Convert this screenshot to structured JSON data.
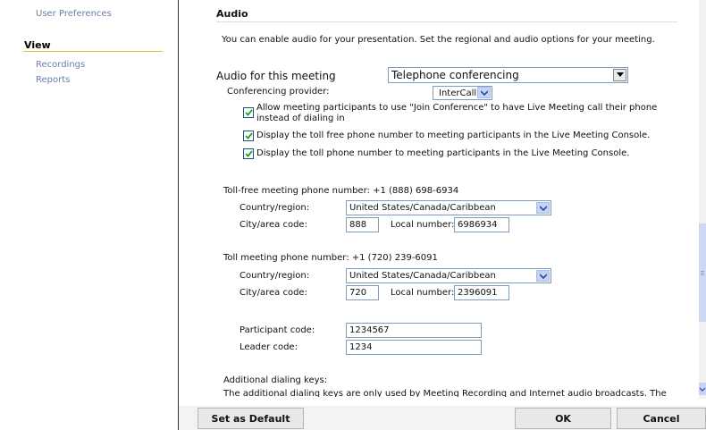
{
  "sidebar": {
    "user_preferences": "User Preferences",
    "view_heading": "View",
    "recordings": "Recordings",
    "reports": "Reports"
  },
  "audio": {
    "section_title": "Audio",
    "intro": "You can enable audio for your presentation. Set the regional and audio options for your meeting.",
    "audio_for_meeting_label": "Audio for this meeting",
    "audio_for_meeting_value": "Telephone conferencing",
    "provider_label": "Conferencing provider:",
    "provider_value": "InterCall",
    "checkboxes": [
      {
        "line1": "Allow meeting participants to use \"Join Conference\" to have Live Meeting call their phone",
        "line2": "instead of dialing in",
        "checked": true
      },
      {
        "line1": "Display the toll free phone number to meeting participants in the Live Meeting Console.",
        "checked": true
      },
      {
        "line1": "Display the toll phone number to meeting participants in the Live Meeting Console.",
        "checked": true
      }
    ]
  },
  "toll_free": {
    "heading": "Toll-free meeting phone number: +1 (888) 698-6934",
    "country_label": "Country/region:",
    "country_value": "United States/Canada/Caribbean",
    "city_label": "City/area code:",
    "city_value": "888",
    "local_label": "Local number:",
    "local_value": "6986934"
  },
  "toll": {
    "heading": "Toll meeting phone number: +1 (720) 239-6091",
    "country_label": "Country/region:",
    "country_value": "United States/Canada/Caribbean",
    "city_label": "City/area code:",
    "city_value": "720",
    "local_label": "Local number:",
    "local_value": "2396091"
  },
  "codes": {
    "participant_label": "Participant code:",
    "participant_value": "1234567",
    "leader_label": "Leader code:",
    "leader_value": "1234"
  },
  "additional": {
    "heading": "Additional dialing keys:",
    "description": "The additional dialing keys are only used by Meeting Recording and Internet audio broadcasts. The"
  },
  "buttons": {
    "set_default": "Set as Default",
    "ok": "OK",
    "cancel": "Cancel"
  },
  "colors": {
    "nav_link": "#6a7ea8",
    "accent_rule": "#f0b44a",
    "checkbox_check": "#21a121",
    "input_border": "#7f9db9"
  }
}
